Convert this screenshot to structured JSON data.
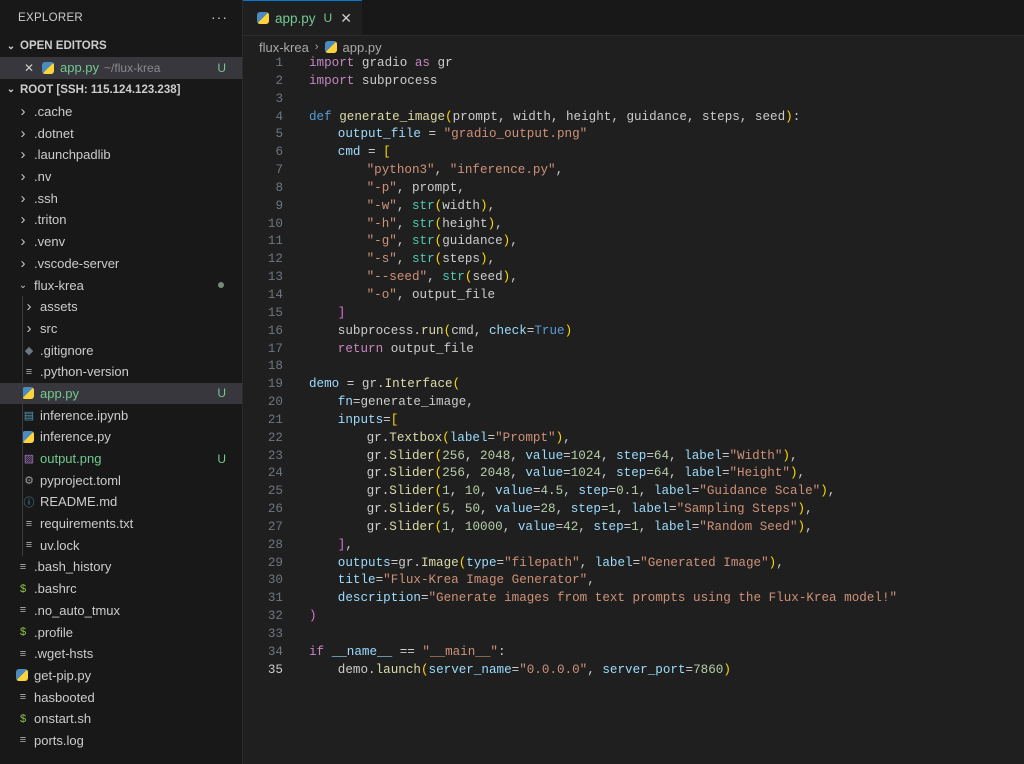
{
  "sidebar": {
    "explorer_title": "EXPLORER",
    "more_actions": "···",
    "open_editors": {
      "header": "OPEN EDITORS",
      "item": {
        "name": "app.py",
        "path": "~/flux-krea",
        "badge": "U"
      }
    },
    "root": {
      "header": "ROOT [SSH: 115.124.123.238]",
      "items": [
        {
          "name": ".cache",
          "type": "folder",
          "depth": 1
        },
        {
          "name": ".dotnet",
          "type": "folder",
          "depth": 1
        },
        {
          "name": ".launchpadlib",
          "type": "folder",
          "depth": 1
        },
        {
          "name": ".nv",
          "type": "folder",
          "depth": 1
        },
        {
          "name": ".ssh",
          "type": "folder",
          "depth": 1
        },
        {
          "name": ".triton",
          "type": "folder",
          "depth": 1
        },
        {
          "name": ".venv",
          "type": "folder",
          "depth": 1
        },
        {
          "name": ".vscode-server",
          "type": "folder",
          "depth": 1
        },
        {
          "name": "flux-krea",
          "type": "folder-open",
          "depth": 1,
          "modified": true
        },
        {
          "name": "assets",
          "type": "folder",
          "depth": 2
        },
        {
          "name": "src",
          "type": "folder",
          "depth": 2
        },
        {
          "name": ".gitignore",
          "type": "git-file",
          "depth": 2
        },
        {
          "name": ".python-version",
          "type": "text-file",
          "depth": 2
        },
        {
          "name": "app.py",
          "type": "python-file",
          "depth": 2,
          "badge": "U",
          "selected": true
        },
        {
          "name": "inference.ipynb",
          "type": "notebook-file",
          "depth": 2
        },
        {
          "name": "inference.py",
          "type": "python-file",
          "depth": 2
        },
        {
          "name": "output.png",
          "type": "image-file",
          "depth": 2,
          "badge": "U"
        },
        {
          "name": "pyproject.toml",
          "type": "settings-file",
          "depth": 2
        },
        {
          "name": "README.md",
          "type": "info-file",
          "depth": 2
        },
        {
          "name": "requirements.txt",
          "type": "text-file",
          "depth": 2
        },
        {
          "name": "uv.lock",
          "type": "text-file",
          "depth": 2
        },
        {
          "name": ".bash_history",
          "type": "text-file",
          "depth": 1
        },
        {
          "name": ".bashrc",
          "type": "shell-file",
          "depth": 1
        },
        {
          "name": ".no_auto_tmux",
          "type": "text-file",
          "depth": 1
        },
        {
          "name": ".profile",
          "type": "shell-file",
          "depth": 1
        },
        {
          "name": ".wget-hsts",
          "type": "text-file",
          "depth": 1
        },
        {
          "name": "get-pip.py",
          "type": "python-file",
          "depth": 1
        },
        {
          "name": "hasbooted",
          "type": "text-file",
          "depth": 1
        },
        {
          "name": "onstart.sh",
          "type": "shell-file",
          "depth": 1
        },
        {
          "name": "ports.log",
          "type": "text-file",
          "depth": 1
        }
      ]
    }
  },
  "editor": {
    "tab": {
      "label": "app.py",
      "badge": "U",
      "close": "✕"
    },
    "breadcrumb": {
      "folder": "flux-krea",
      "file": "app.py"
    },
    "current_line": 35,
    "lines": [
      {
        "n": "1",
        "text": "import gradio as gr"
      },
      {
        "n": "2",
        "text": "import subprocess"
      },
      {
        "n": "3",
        "text": ""
      },
      {
        "n": "4",
        "text": "def generate_image(prompt, width, height, guidance, steps, seed):"
      },
      {
        "n": "5",
        "text": "    output_file = \"gradio_output.png\""
      },
      {
        "n": "6",
        "text": "    cmd = ["
      },
      {
        "n": "7",
        "text": "        \"python3\", \"inference.py\","
      },
      {
        "n": "8",
        "text": "        \"-p\", prompt,"
      },
      {
        "n": "9",
        "text": "        \"-w\", str(width),"
      },
      {
        "n": "10",
        "text": "        \"-h\", str(height),"
      },
      {
        "n": "11",
        "text": "        \"-g\", str(guidance),"
      },
      {
        "n": "12",
        "text": "        \"-s\", str(steps),"
      },
      {
        "n": "13",
        "text": "        \"--seed\", str(seed),"
      },
      {
        "n": "14",
        "text": "        \"-o\", output_file"
      },
      {
        "n": "15",
        "text": "    ]"
      },
      {
        "n": "16",
        "text": "    subprocess.run(cmd, check=True)"
      },
      {
        "n": "17",
        "text": "    return output_file"
      },
      {
        "n": "18",
        "text": ""
      },
      {
        "n": "19",
        "text": "demo = gr.Interface("
      },
      {
        "n": "20",
        "text": "    fn=generate_image,"
      },
      {
        "n": "21",
        "text": "    inputs=["
      },
      {
        "n": "22",
        "text": "        gr.Textbox(label=\"Prompt\"),"
      },
      {
        "n": "23",
        "text": "        gr.Slider(256, 2048, value=1024, step=64, label=\"Width\"),"
      },
      {
        "n": "24",
        "text": "        gr.Slider(256, 2048, value=1024, step=64, label=\"Height\"),"
      },
      {
        "n": "25",
        "text": "        gr.Slider(1, 10, value=4.5, step=0.1, label=\"Guidance Scale\"),"
      },
      {
        "n": "26",
        "text": "        gr.Slider(5, 50, value=28, step=1, label=\"Sampling Steps\"),"
      },
      {
        "n": "27",
        "text": "        gr.Slider(1, 10000, value=42, step=1, label=\"Random Seed\"),"
      },
      {
        "n": "28",
        "text": "    ],"
      },
      {
        "n": "29",
        "text": "    outputs=gr.Image(type=\"filepath\", label=\"Generated Image\"),"
      },
      {
        "n": "30",
        "text": "    title=\"Flux-Krea Image Generator\","
      },
      {
        "n": "31",
        "text": "    description=\"Generate images from text prompts using the Flux-Krea model!\""
      },
      {
        "n": "32",
        "text": ")"
      },
      {
        "n": "33",
        "text": ""
      },
      {
        "n": "34",
        "text": "if __name__ == \"__main__\":"
      },
      {
        "n": "35",
        "text": "    demo.launch(server_name=\"0.0.0.0\", server_port=7860)"
      }
    ]
  },
  "colors": {
    "accent": "#0078d4",
    "untracked": "#73c991",
    "selected_row": "#37373d"
  }
}
